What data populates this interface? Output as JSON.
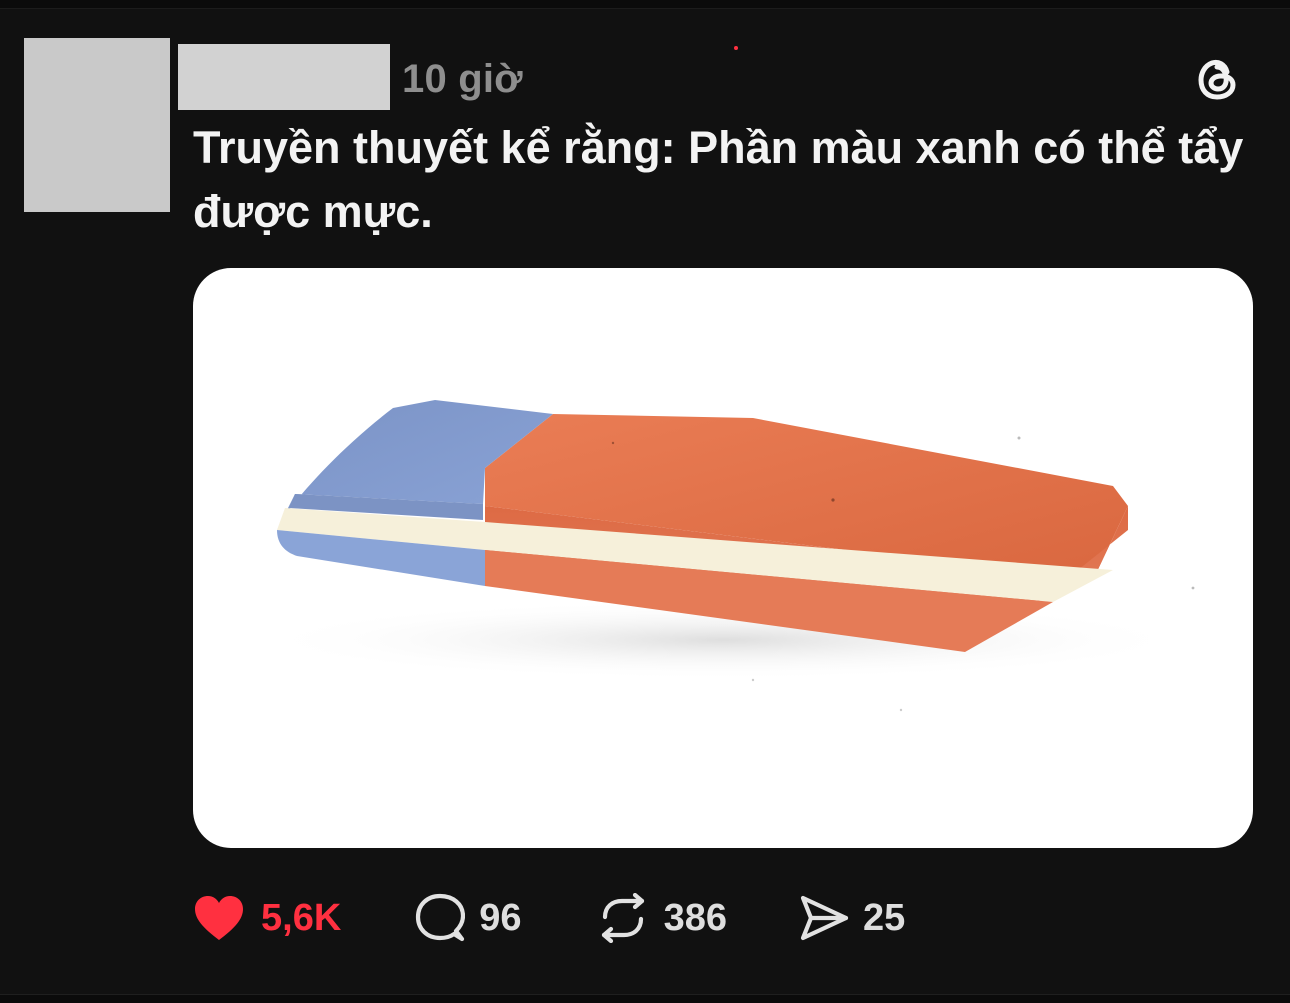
{
  "post": {
    "timestamp": "10 giờ",
    "caption": "Truyền thuyết kể rằng: Phần màu xanh có thể tẩy được mực.",
    "media": {
      "description": "",
      "colors": {
        "blue": "#7f9ccf",
        "orange": "#e0704a",
        "stripe": "#f5f0dc"
      }
    },
    "actions": {
      "like_count": "5,6K",
      "reply_count": "96",
      "repost_count": "386",
      "share_count": "25"
    }
  },
  "colors": {
    "background": "#111111",
    "like_red": "#ff3040",
    "text": "#f3f3f3",
    "muted": "#8e8e8e"
  },
  "icons": {
    "logo": "threads-logo-icon",
    "like": "heart-icon",
    "reply": "comment-icon",
    "repost": "repost-icon",
    "share": "send-icon"
  }
}
